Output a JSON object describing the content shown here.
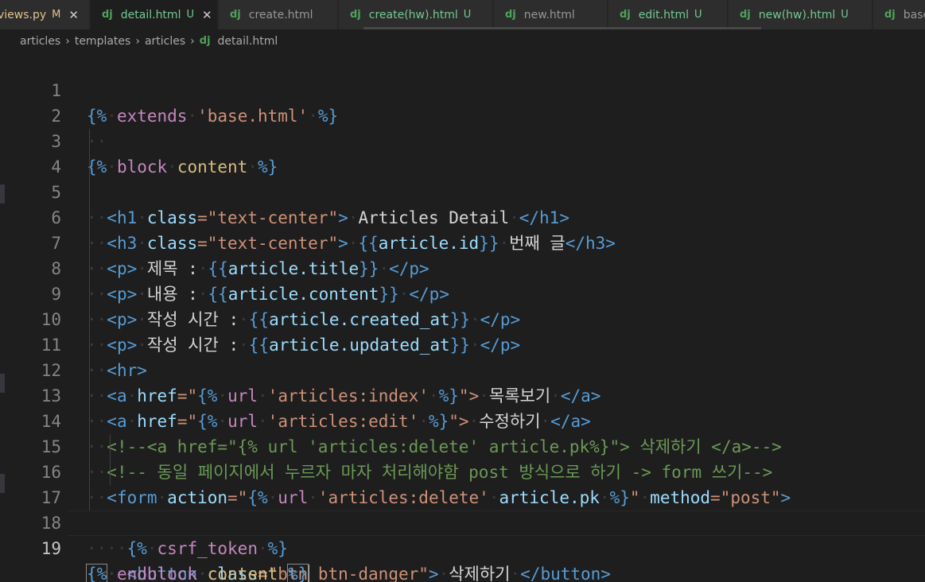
{
  "tabs": [
    {
      "label": "views.py",
      "badge": "M"
    },
    {
      "label": "detail.html",
      "badge": "U",
      "close": "✕"
    },
    {
      "label": "create.html",
      "badge": ""
    },
    {
      "label": "create(hw).html",
      "badge": "U"
    },
    {
      "label": "new.html",
      "badge": ""
    },
    {
      "label": "edit.html",
      "badge": "U"
    },
    {
      "label": "new(hw).html",
      "badge": "U"
    },
    {
      "label": "base",
      "badge": ""
    }
  ],
  "file_icon": "dj",
  "breadcrumb": [
    "articles",
    "templates",
    "articles",
    "detail.html"
  ],
  "breadcrumb_sep": "›",
  "line_numbers": [
    "1",
    "2",
    "3",
    "4",
    "5",
    "6",
    "7",
    "8",
    "9",
    "10",
    "11",
    "12",
    "13",
    "14",
    "15",
    "16",
    "17",
    "18",
    "19"
  ],
  "current_line": 19,
  "code": {
    "l1": [
      "{%",
      "extends",
      "'base.html'",
      "%}"
    ],
    "l3": [
      "{%",
      "block",
      "content",
      "%}"
    ],
    "l4": [
      "<h1",
      "class",
      "=\"text-center\"",
      ">",
      "Articles Detail",
      "</h1>"
    ],
    "l5": [
      "<h3",
      "class",
      "=\"text-center\"",
      ">",
      "{{",
      "article.id",
      "}}",
      "번째 글",
      "</h3>"
    ],
    "l6": [
      "<p>",
      "제목 :",
      "{{",
      "article.title",
      "}}",
      "</p>"
    ],
    "l7": [
      "<p>",
      "내용 :",
      "{{",
      "article.content",
      "}}",
      "</p>"
    ],
    "l8": [
      "<p>",
      "작성 시간 :",
      "{{",
      "article.created_at",
      "}}",
      "</p>"
    ],
    "l9": [
      "<p>",
      "작성 시간 :",
      "{{",
      "article.updated_at",
      "}}",
      "</p>"
    ],
    "l10": [
      "<hr>"
    ],
    "l11": [
      "<a",
      "href",
      "=\"",
      "{%",
      "url",
      "'articles:index'",
      "%}",
      "\">",
      "목록보기",
      "</a>"
    ],
    "l12": [
      "<a",
      "href",
      "=\"",
      "{%",
      "url",
      "'articles:edit'",
      "%}",
      "\">",
      "수정하기",
      "</a>"
    ],
    "l13": [
      "<!--<a href=\"{% url 'articles:delete' article.pk%}\"> 삭제하기 </a>-->"
    ],
    "l14": [
      "<!-- 동일 페이지에서 누르자 마자 처리해야함 post 방식으로 하기 -> form 쓰기-->"
    ],
    "l15": [
      "<form",
      "action",
      "=\"",
      "{%",
      "url",
      "'articles:delete'",
      "article.pk",
      "%}",
      "\"",
      "method",
      "=\"post\"",
      ">"
    ],
    "l16": [
      "{%",
      "csrf_token",
      "%}"
    ],
    "l17": [
      "<button",
      "class",
      "=\"btn btn-danger\"",
      ">",
      "삭제하기",
      "</button>"
    ],
    "l19": [
      "{%",
      "endblock",
      "content",
      "%}"
    ]
  },
  "colors": {
    "background": "#1e1e1e",
    "tab_bg": "#2d2d2d",
    "active_tab_bg": "#1e1e1e",
    "untracked": "#73c991",
    "modified": "#e2c08d",
    "django_icon": "#4fa25a"
  }
}
